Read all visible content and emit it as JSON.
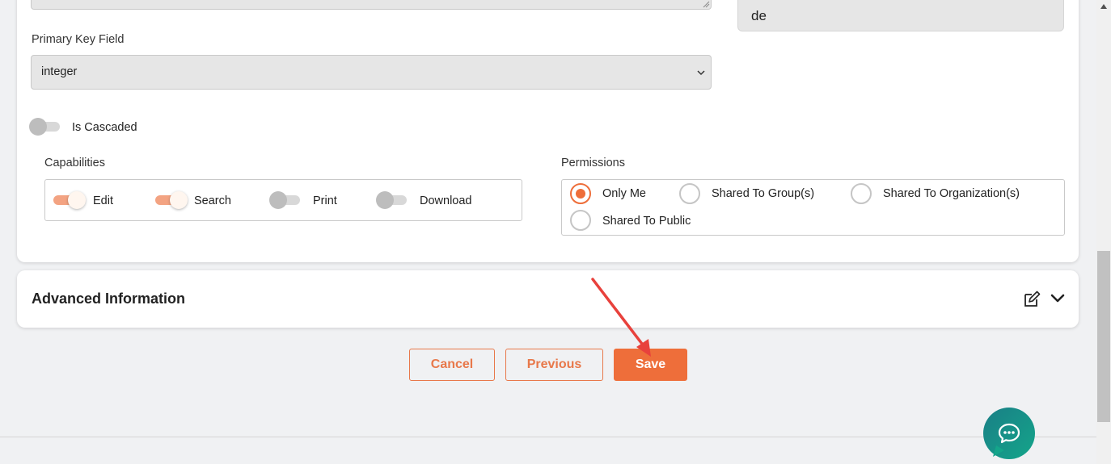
{
  "form": {
    "language_value": "de",
    "primary_key_label": "Primary Key Field",
    "primary_key_value": "integer",
    "is_cascaded_label": "Is Cascaded",
    "is_cascaded_on": false
  },
  "capabilities": {
    "title": "Capabilities",
    "items": [
      {
        "label": "Edit",
        "on": true
      },
      {
        "label": "Search",
        "on": true
      },
      {
        "label": "Print",
        "on": false
      },
      {
        "label": "Download",
        "on": false
      }
    ]
  },
  "permissions": {
    "title": "Permissions",
    "options": [
      {
        "label": "Only Me",
        "selected": true
      },
      {
        "label": "Shared To Group(s)",
        "selected": false
      },
      {
        "label": "Shared To Organization(s)",
        "selected": false
      },
      {
        "label": "Shared To Public",
        "selected": false
      }
    ]
  },
  "advanced": {
    "title": "Advanced Information"
  },
  "actions": {
    "cancel_label": "Cancel",
    "previous_label": "Previous",
    "save_label": "Save"
  },
  "colors": {
    "accent": "#ee6e3a",
    "toggle_on_track": "#f3a382",
    "chat_gradient_start": "#1a7f86",
    "chat_gradient_end": "#14a58a",
    "annotation_arrow": "#e8413c"
  },
  "icons": {
    "edit": "edit-icon",
    "expand": "chevron-down-icon",
    "chat": "chat-icon",
    "select": "chevron-down-icon"
  }
}
